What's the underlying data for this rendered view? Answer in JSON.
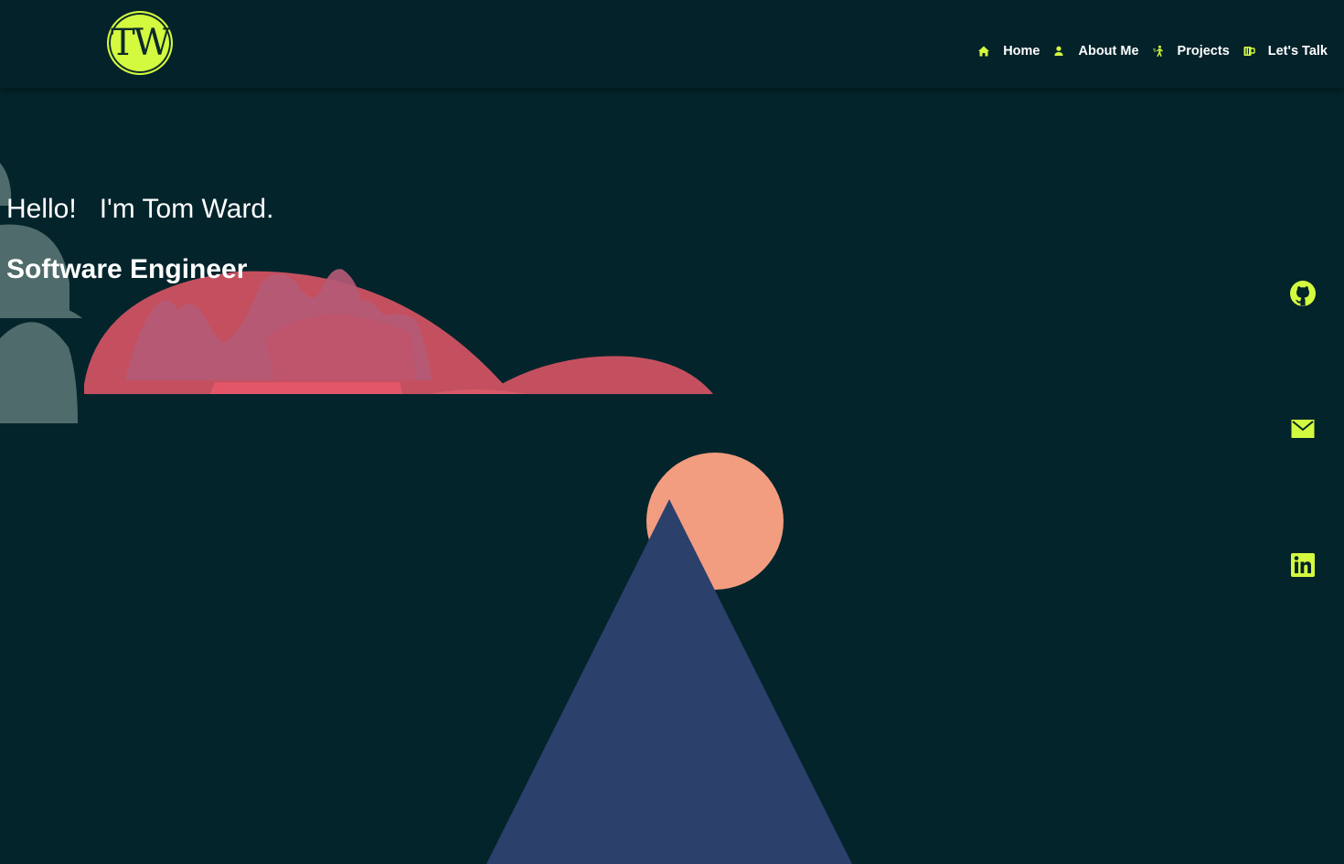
{
  "header": {
    "logo_text": "TW",
    "nav": [
      {
        "label": "Home",
        "icon": "home-icon"
      },
      {
        "label": "About Me",
        "icon": "user-icon"
      },
      {
        "label": "Projects",
        "icon": "person-running-icon"
      },
      {
        "label": "Let's Talk",
        "icon": "mug-icon"
      }
    ]
  },
  "hero": {
    "title": "Hello!   I'm Tom Ward.",
    "subtitle": "Software Engineer"
  },
  "social": [
    {
      "name": "github-icon"
    },
    {
      "name": "mail-icon"
    },
    {
      "name": "linkedin-icon"
    }
  ],
  "colors": {
    "background": "#03242b",
    "accent": "#d4fa3f",
    "text": "#ffffff",
    "sun": "#f29d80",
    "mountain": "#2b406b",
    "hill_red": "#c4505f",
    "hill_pink": "#b45a76",
    "hill_grey": "#4f6b6b"
  }
}
